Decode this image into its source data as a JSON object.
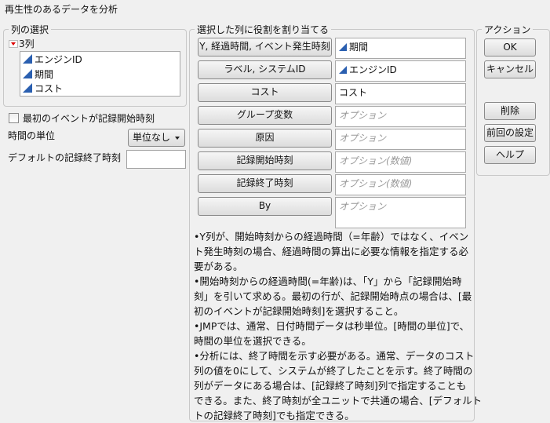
{
  "title": "再生性のあるデータを分析",
  "column_select": {
    "label": "列の選択",
    "count_label": "3列",
    "columns": [
      "エンジンID",
      "期間",
      "コスト"
    ]
  },
  "options": {
    "first_event_checkbox": "最初のイベントが記録開始時刻",
    "first_event_checked": false,
    "time_unit_label": "時間の単位",
    "time_unit_value": "単位なし",
    "default_end_label": "デフォルトの記録終了時刻",
    "default_end_value": ""
  },
  "roles": {
    "label": "選択した列に役割を割り当てる",
    "items": [
      {
        "button": "Y, 経過時間, イベント発生時刻",
        "value": "期間",
        "placeholder": "",
        "is_column": true
      },
      {
        "button": "ラベル, システムID",
        "value": "エンジンID",
        "placeholder": "",
        "is_column": true
      },
      {
        "button": "コスト",
        "value": "コスト",
        "placeholder": "",
        "is_column": false
      },
      {
        "button": "グループ変数",
        "value": "",
        "placeholder": "オプション"
      },
      {
        "button": "原因",
        "value": "",
        "placeholder": "オプション"
      },
      {
        "button": "記録開始時刻",
        "value": "",
        "placeholder": "オプション(数値)"
      },
      {
        "button": "記録終了時刻",
        "value": "",
        "placeholder": "オプション(数値)"
      },
      {
        "button": "By",
        "value": "",
        "placeholder": "オプション"
      }
    ]
  },
  "notes": [
    "•Y列が、開始時刻からの経過時間（=年齢）ではなく、イベン",
    "ト発生時刻の場合、経過時間の算出に必要な情報を指定する必",
    "要がある。",
    "•開始時刻からの経過時間(=年齢)は、「Y」から「記録開始時",
    "刻」を引いて求める。最初の行が、記録開始時点の場合は、[最",
    "初のイベントが記録開始時刻]を選択すること。",
    "•JMPでは、通常、日付時間データは秒単位。[時間の単位]で、",
    "時間の単位を選択できる。",
    "•分析には、終了時間を示す必要がある。通常、データのコスト",
    "列の値を0にして、システムが終了したことを示す。終了時間の",
    "列がデータにある場合は、[記録終了時刻]列で指定することも",
    "できる。また、終了時刻が全ユニットで共通の場合、[デフォルト",
    "トの記録終了時刻]でも指定できる。"
  ],
  "actions": {
    "label": "アクション",
    "ok": "OK",
    "cancel": "キャンセル",
    "remove": "削除",
    "recall": "前回の設定",
    "help": "ヘルプ"
  }
}
